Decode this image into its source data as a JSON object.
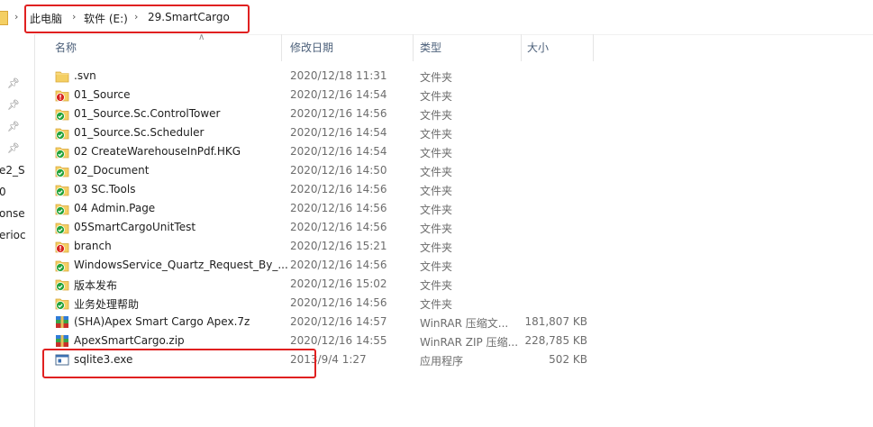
{
  "breadcrumb": {
    "items": [
      "此电脑",
      "软件 (E:)",
      "29.SmartCargo"
    ]
  },
  "nav": {
    "clipped_labels": [
      "e2_S",
      "0",
      "onse",
      "erioc"
    ]
  },
  "columns": {
    "name": "名称",
    "date": "修改日期",
    "type": "类型",
    "size": "大小"
  },
  "files": [
    {
      "name": ".svn",
      "date": "2020/12/18 11:31",
      "type": "文件夹",
      "size": "",
      "icon": "folder-icon"
    },
    {
      "name": "01_Source",
      "date": "2020/12/16 14:54",
      "type": "文件夹",
      "size": "",
      "icon": "folder-conflict-icon"
    },
    {
      "name": "01_Source.Sc.ControlTower",
      "date": "2020/12/16 14:56",
      "type": "文件夹",
      "size": "",
      "icon": "folder-ok-icon"
    },
    {
      "name": "01_Source.Sc.Scheduler",
      "date": "2020/12/16 14:54",
      "type": "文件夹",
      "size": "",
      "icon": "folder-ok-icon"
    },
    {
      "name": "02 CreateWarehouseInPdf.HKG",
      "date": "2020/12/16 14:54",
      "type": "文件夹",
      "size": "",
      "icon": "folder-ok-icon"
    },
    {
      "name": "02_Document",
      "date": "2020/12/16 14:50",
      "type": "文件夹",
      "size": "",
      "icon": "folder-ok-icon"
    },
    {
      "name": "03 SC.Tools",
      "date": "2020/12/16 14:56",
      "type": "文件夹",
      "size": "",
      "icon": "folder-ok-icon"
    },
    {
      "name": "04 Admin.Page",
      "date": "2020/12/16 14:56",
      "type": "文件夹",
      "size": "",
      "icon": "folder-ok-icon"
    },
    {
      "name": "05SmartCargoUnitTest",
      "date": "2020/12/16 14:56",
      "type": "文件夹",
      "size": "",
      "icon": "folder-ok-icon"
    },
    {
      "name": "branch",
      "date": "2020/12/16 15:21",
      "type": "文件夹",
      "size": "",
      "icon": "folder-conflict-icon"
    },
    {
      "name": "WindowsService_Quartz_Request_By_...",
      "date": "2020/12/16 14:56",
      "type": "文件夹",
      "size": "",
      "icon": "folder-ok-icon"
    },
    {
      "name": "版本发布",
      "date": "2020/12/16 15:02",
      "type": "文件夹",
      "size": "",
      "icon": "folder-ok-icon"
    },
    {
      "name": "业务处理帮助",
      "date": "2020/12/16 14:56",
      "type": "文件夹",
      "size": "",
      "icon": "folder-ok-icon"
    },
    {
      "name": "(SHA)Apex Smart Cargo Apex.7z",
      "date": "2020/12/16 14:57",
      "type": "WinRAR 压缩文...",
      "size": "181,807 KB",
      "icon": "winrar-archive-icon"
    },
    {
      "name": "ApexSmartCargo.zip",
      "date": "2020/12/16 14:55",
      "type": "WinRAR ZIP 压缩...",
      "size": "228,785 KB",
      "icon": "winrar-archive-icon"
    },
    {
      "name": "sqlite3.exe",
      "date": "2013/9/4 1:27",
      "type": "应用程序",
      "size": "502 KB",
      "icon": "exe-icon"
    }
  ],
  "colors": {
    "highlight_red": "#e02020",
    "folder_yellow": "#f4cf63",
    "svn_ok_green": "#22a33a",
    "svn_conflict_red": "#d8231f"
  }
}
